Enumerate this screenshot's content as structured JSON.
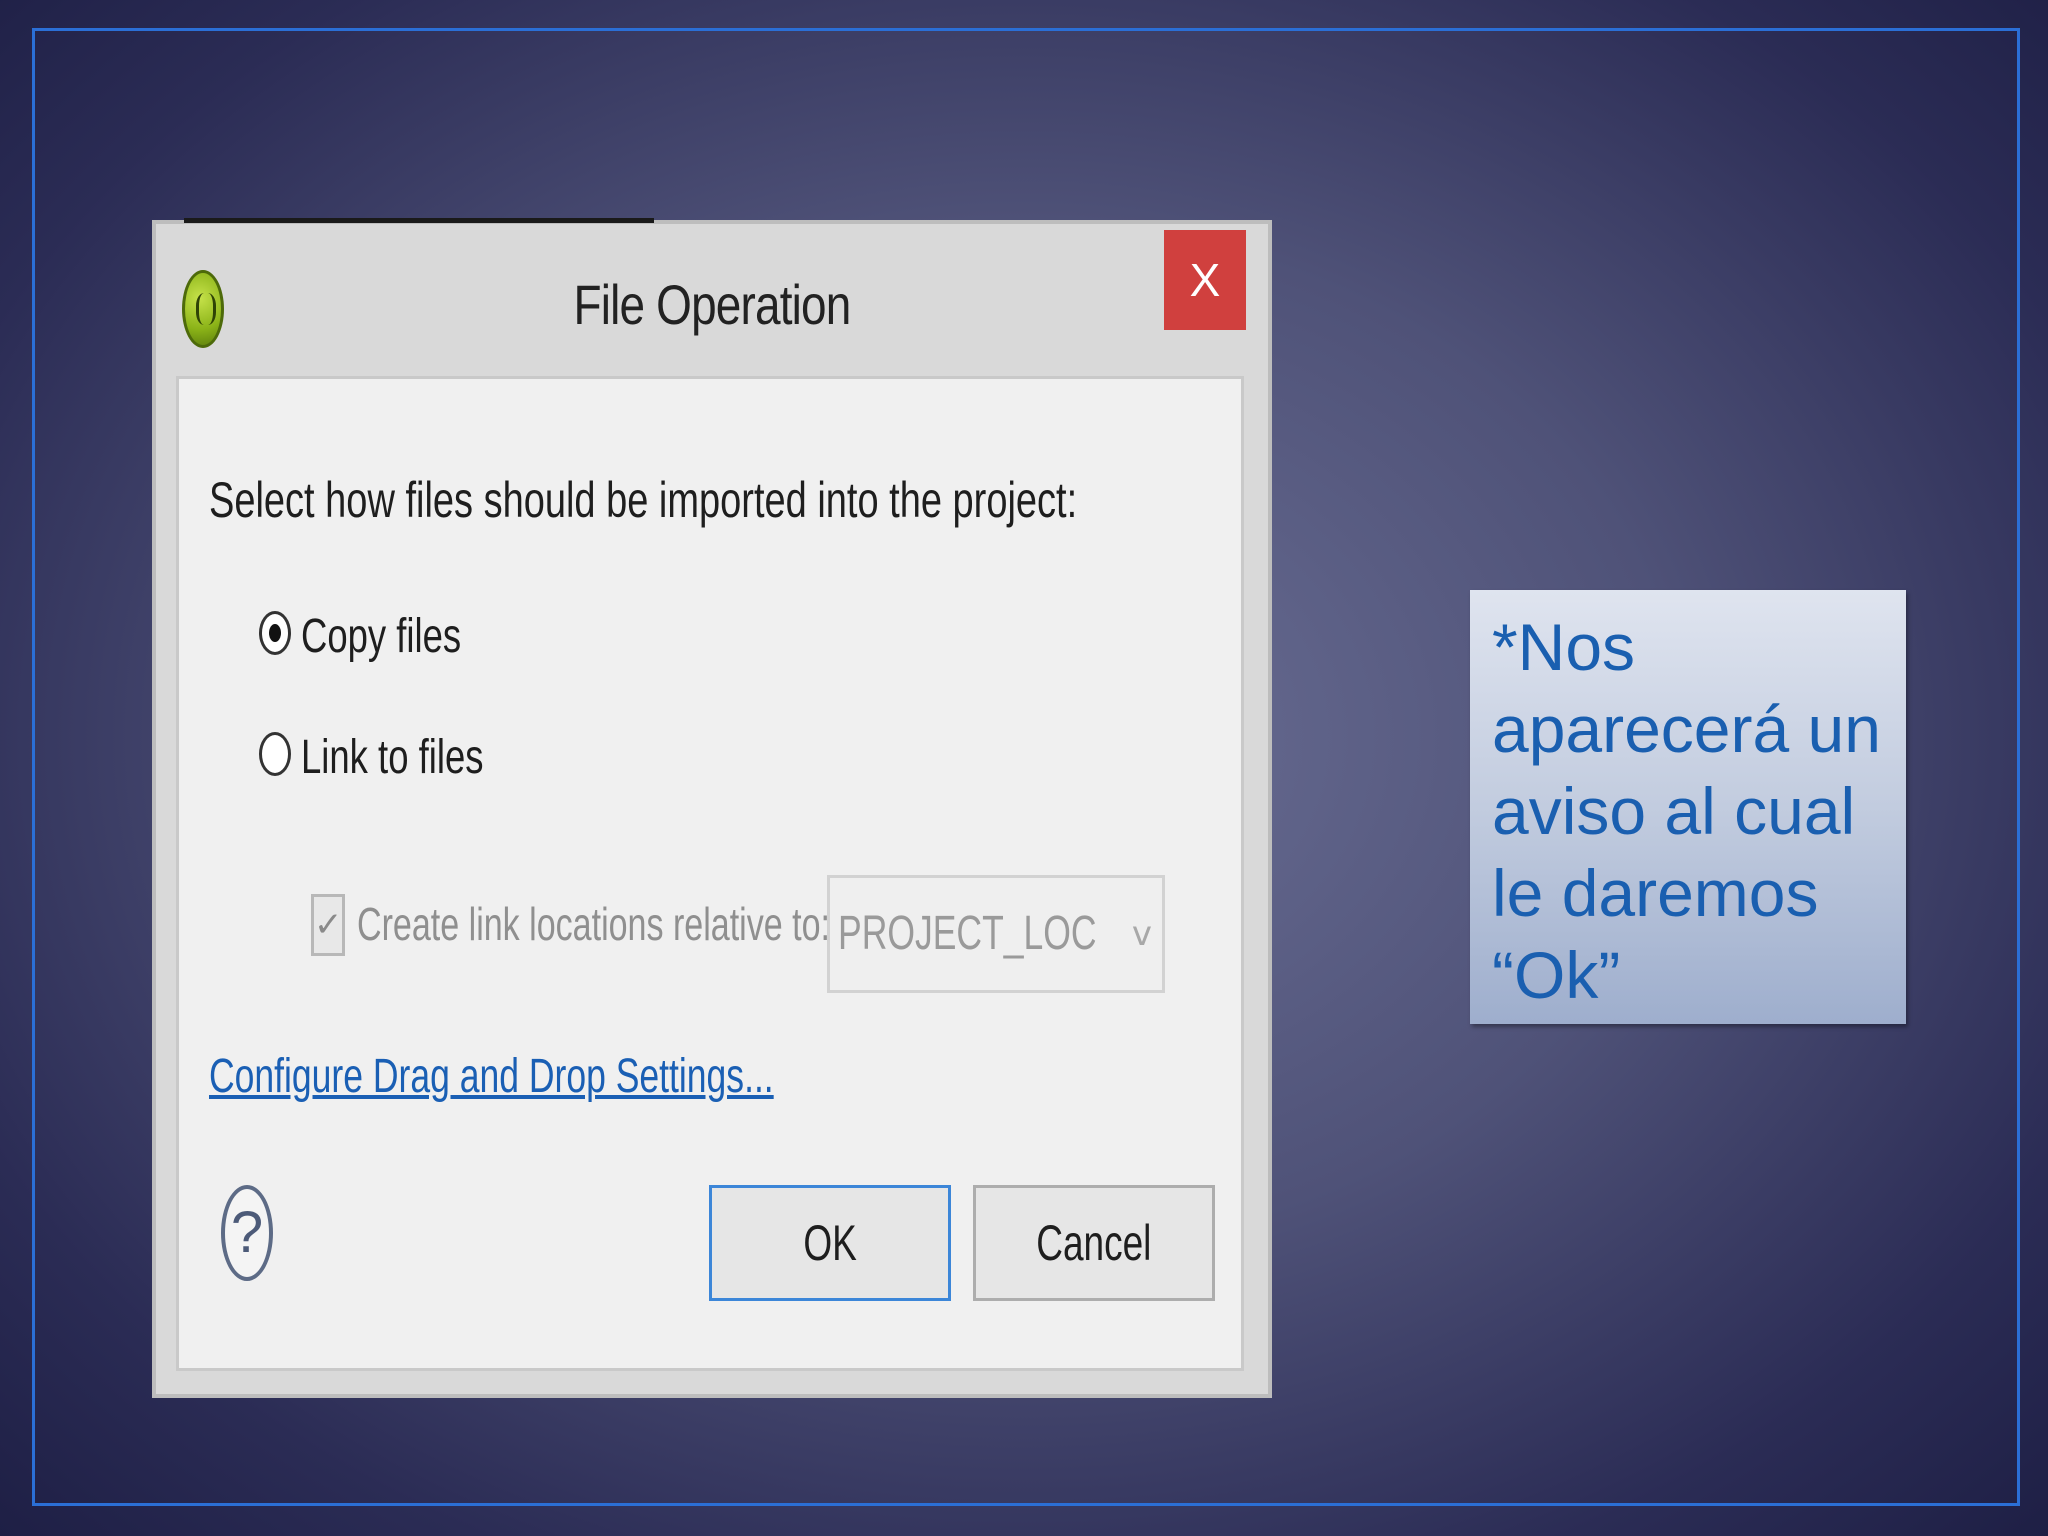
{
  "dialog": {
    "title": "File Operation",
    "close_label": "X",
    "instruction": "Select how files should be imported into the project:",
    "options": [
      {
        "label": "Copy files",
        "selected": true
      },
      {
        "label": "Link to files",
        "selected": false
      }
    ],
    "relative_checkbox": {
      "label": "Create link locations relative to:",
      "checked": true,
      "enabled": false,
      "mark": "✓"
    },
    "relative_select": {
      "value": "PROJECT_LOC",
      "arrow": "v"
    },
    "configure_link": "Configure Drag and Drop Settings...",
    "help_glyph": "?",
    "ok_label": "OK",
    "cancel_label": "Cancel",
    "icons": {
      "app": "eclipse-app-icon",
      "help": "help-icon",
      "close": "close-icon"
    }
  },
  "note": {
    "text": "*Nos aparecerá un aviso al cual le daremos “Ok”"
  },
  "colors": {
    "frame_border": "#2b6fd6",
    "close_button": "#d0403e",
    "link": "#1a5fb4",
    "note_text": "#1a5fb0"
  }
}
